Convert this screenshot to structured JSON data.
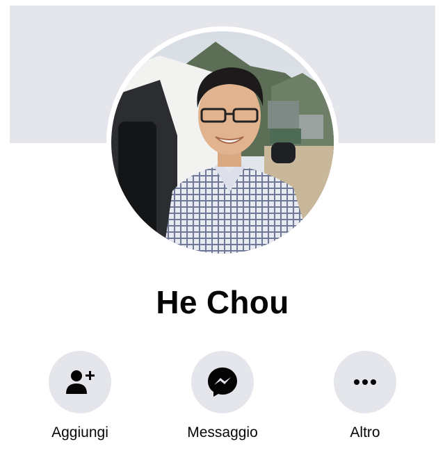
{
  "profile": {
    "name": "He Chou"
  },
  "actions": [
    {
      "label": "Aggiungi",
      "icon": "add-friend-icon"
    },
    {
      "label": "Messaggio",
      "icon": "messenger-icon"
    },
    {
      "label": "Altro",
      "icon": "more-icon"
    }
  ],
  "colors": {
    "cover": "#e4e6eb",
    "action_bg": "#e4e6eb",
    "text": "#050505",
    "icon": "#050505"
  }
}
